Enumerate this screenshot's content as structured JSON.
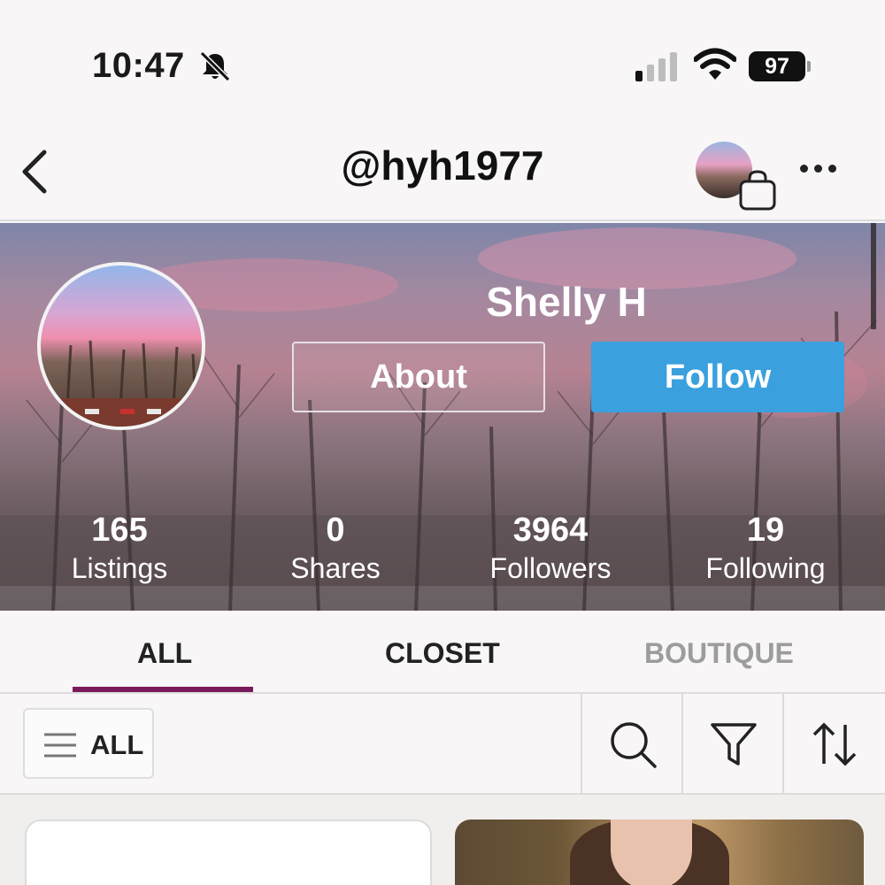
{
  "status_bar": {
    "time": "10:47",
    "battery": "97"
  },
  "header": {
    "handle": "@hyh1977"
  },
  "profile": {
    "display_name": "Shelly H",
    "about_label": "About",
    "follow_label": "Follow",
    "stats": [
      {
        "value": "165",
        "label": "Listings"
      },
      {
        "value": "0",
        "label": "Shares"
      },
      {
        "value": "3964",
        "label": "Followers"
      },
      {
        "value": "19",
        "label": "Following"
      }
    ]
  },
  "tabs": [
    {
      "label": "ALL",
      "active": true
    },
    {
      "label": "CLOSET",
      "active": false
    },
    {
      "label": "BOUTIQUE",
      "active": false
    }
  ],
  "filter_bar": {
    "category_label": "ALL"
  },
  "icons": [
    "bell-slash-icon",
    "signal-icon",
    "wifi-icon",
    "battery-icon",
    "back-icon",
    "shopping-bag-icon",
    "more-icon",
    "menu-icon",
    "search-icon",
    "filter-icon",
    "sort-icon"
  ],
  "colors": {
    "follow_button": "#3aa0de",
    "active_tab_underline": "#7b1a5b",
    "inactive_tab": "#9c9c9c"
  }
}
